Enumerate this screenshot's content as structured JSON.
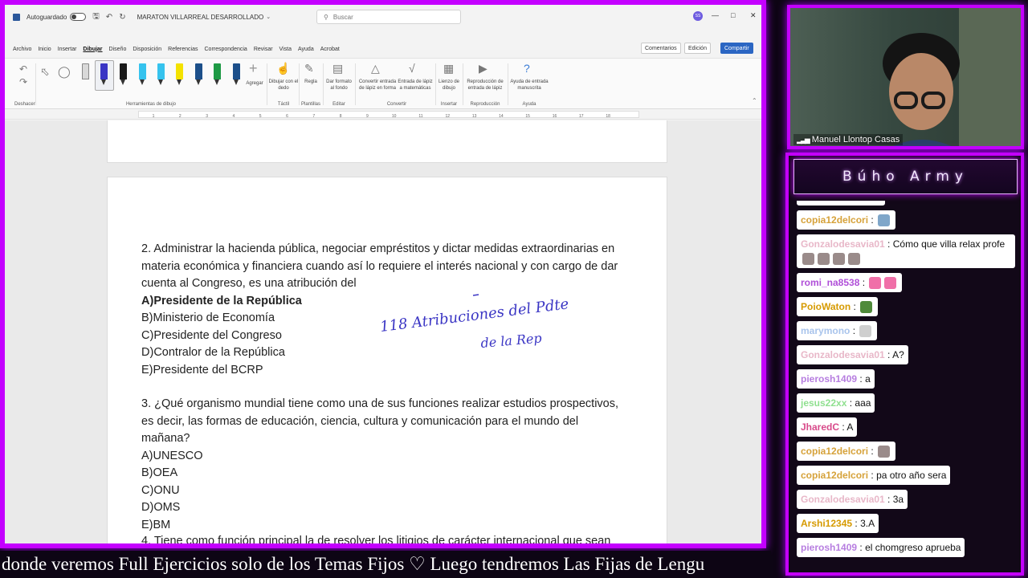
{
  "word": {
    "autosave_label": "Autoguardado",
    "doc_title": "MARATON VILLARREAL DESARROLLADO",
    "search_placeholder": "Buscar",
    "avatar_initials": "SS",
    "menu": [
      "Archivo",
      "Inicio",
      "Insertar",
      "Dibujar",
      "Diseño",
      "Disposición",
      "Referencias",
      "Correspondencia",
      "Revisar",
      "Vista",
      "Ayuda",
      "Acrobat"
    ],
    "active_menu": "Dibujar",
    "comments_label": "Comentarios",
    "editing_label": "Edición",
    "share_label": "Compartir",
    "ribbon": {
      "undo_group": "Deshacer",
      "drawing_tools_group": "Herramientas de dibujo",
      "add_label": "Agregar",
      "draw_finger_label": "Dibujar con el dedo",
      "ruler_label": "Regla",
      "format_bg_label": "Dar formato al fondo",
      "convert_shape_label": "Convertir entrada de lápiz en forma",
      "ink_math_label": "Entrada de lápiz a matemáticas",
      "canvas_label": "Lienzo de dibujo",
      "replay_label": "Reproducción de entrada de lápiz",
      "ink_help_label": "Ayuda de entrada manuscrita",
      "tactil_group": "Táctil",
      "templates_group": "Plantillas",
      "edit_group": "Editar",
      "convert_group": "Convertir",
      "insert_group": "Insertar",
      "replay_group": "Reproducción",
      "help_group": "Ayuda",
      "pen_colors": [
        "#1a1a1a",
        "#36c3ee",
        "#36c3ee",
        "#f4e200",
        "#3a6fd0",
        "#1c4f8a",
        "#1e9a45",
        "#1c4f8a"
      ]
    },
    "ruler_ticks": [
      "1",
      "2",
      "3",
      "4",
      "5",
      "6",
      "7",
      "8",
      "9",
      "10",
      "11",
      "12",
      "13",
      "14",
      "15",
      "16",
      "17",
      "18"
    ]
  },
  "document": {
    "q2_text": "2. Administrar la hacienda pública, negociar empréstitos y dictar medidas extraordinarias en materia económica y financiera cuando así lo requiere el interés nacional y con cargo de dar cuenta al Congreso, es una atribución del",
    "q2_options": [
      {
        "letter": "A)",
        "text": "Presidente de la República",
        "bold": true
      },
      {
        "letter": "B)",
        "text": "Ministerio de Economía",
        "bold": false
      },
      {
        "letter": "C)",
        "text": "Presidente del Congreso",
        "bold": false
      },
      {
        "letter": "D)",
        "text": "Contralor de la República",
        "bold": false
      },
      {
        "letter": "E)",
        "text": "Presidente del BCRP",
        "bold": false
      }
    ],
    "q3_text": "3. ¿Qué organismo mundial tiene como una de sus funciones realizar estudios prospectivos, es decir, las formas de educación, ciencia, cultura y comunicación para el mundo del mañana?",
    "q3_options": [
      {
        "letter": "A)",
        "text": "UNESCO"
      },
      {
        "letter": "B)",
        "text": "OEA"
      },
      {
        "letter": "C)",
        "text": "ONU"
      },
      {
        "letter": "D)",
        "text": "OMS"
      },
      {
        "letter": "E)",
        "text": "BM"
      }
    ],
    "q4_partial": "4. Tiene como función principal la de resolver los litigios de carácter internacional que sean",
    "handwriting_line1": "118 Atribuciones del Pdte",
    "handwriting_line2": "de la Rep",
    "ink_color": "#3a35c4"
  },
  "webcam": {
    "name": "Manuel Llontop Casas"
  },
  "chat": {
    "title": "Búho Army",
    "messages": [
      {
        "user": "copia12delcori",
        "color": "#d6a23a",
        "text": "",
        "emotes": [
          "#7fa6c9"
        ]
      },
      {
        "user": "Gonzalodesavia01",
        "color": "#e8b7c8",
        "text": "Cómo que villa relax profe",
        "emotes": [
          "#9a8b8a",
          "#9a8b8a",
          "#9a8b8a",
          "#9a8b8a"
        ]
      },
      {
        "user": "romi_na8538",
        "color": "#b04fd8",
        "text": "",
        "emotes": [
          "#f06fa8",
          "#f06fa8"
        ]
      },
      {
        "user": "PoioWaton",
        "color": "#d69a00",
        "text": "",
        "emotes": [
          "#4f8a3a"
        ]
      },
      {
        "user": "marymono",
        "color": "#a9c4ec",
        "text": "",
        "emotes": [
          "#cfcfcf"
        ]
      },
      {
        "user": "Gonzalodesavia01",
        "color": "#e8b7c8",
        "text": "A?",
        "emotes": []
      },
      {
        "user": "pierosh1409",
        "color": "#b77ee0",
        "text": "a",
        "emotes": []
      },
      {
        "user": "jesus22xx",
        "color": "#8fe08f",
        "text": "aaa",
        "emotes": []
      },
      {
        "user": "JharedC",
        "color": "#d84a8a",
        "text": "A",
        "emotes": []
      },
      {
        "user": "copia12delcori",
        "color": "#d6a23a",
        "text": "",
        "emotes": [
          "#9a8b8a"
        ]
      },
      {
        "user": "copia12delcori",
        "color": "#d6a23a",
        "text": "pa otro año sera",
        "emotes": []
      },
      {
        "user": "Gonzalodesavia01",
        "color": "#e8b7c8",
        "text": "3a",
        "emotes": []
      },
      {
        "user": "Arshi12345",
        "color": "#d69a00",
        "text": "3.A",
        "emotes": []
      },
      {
        "user": "pierosh1409",
        "color": "#b77ee0",
        "text": "el chomgreso aprueba",
        "emotes": []
      }
    ]
  },
  "ticker": {
    "text": "donde veremos Full Ejercicios solo de los Temas Fijos   ♡   Luego tendremos Las Fijas de Lengu"
  }
}
